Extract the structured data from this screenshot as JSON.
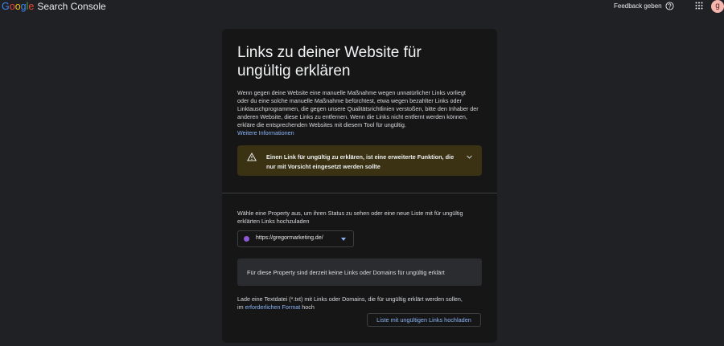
{
  "header": {
    "logo_letters": [
      "G",
      "o",
      "o",
      "g",
      "l",
      "e"
    ],
    "product": "Search Console",
    "feedback": "Feedback geben",
    "avatar_initial": "g"
  },
  "card": {
    "title": "Links zu deiner Website für ungültig erklären",
    "intro": "Wenn gegen deine Website eine manuelle Maßnahme wegen unnatürlicher Links vorliegt oder du eine solche manuelle Maßnahme befürchtest, etwa wegen bezahlter Links oder Linktauschprogrammen, die gegen unsere Qualitätsrichtlinien verstoßen, bitte den Inhaber der anderen Website, diese Links zu entfernen. Wenn die Links nicht entfernt werden können, erkläre die entsprechenden Websites mit diesem Tool für ungültig.",
    "more_info": "Weitere Informationen",
    "warning": "Einen Link für ungültig zu erklären, ist eine erweiterte Funktion, die nur mit Vorsicht eingesetzt werden sollte",
    "property_prompt": "Wähle eine Property aus, um ihren Status zu sehen oder eine neue Liste mit für ungültig erklärten Links hochzuladen",
    "property_value": "https://gregormarketing.de/",
    "empty_state": "Für diese Property sind derzeit keine Links oder Domains für ungültig erklärt",
    "upload_text_pre": "Lade eine Textdatei (*.txt) mit Links oder Domains, die für ungültig erklärt werden sollen, im ",
    "upload_text_link": "erforderlichen Format",
    "upload_text_post": " hoch",
    "upload_button": "Liste mit ungültigen Links hochladen"
  },
  "colors": {
    "background": "#202124",
    "card": "#161617",
    "warning_bg": "#3b3213",
    "link": "#8ab4f8",
    "property_dot": "#8e58d6"
  },
  "icons": [
    "help-icon",
    "apps-icon",
    "warning-icon",
    "chevron-down-icon",
    "property-favicon"
  ]
}
